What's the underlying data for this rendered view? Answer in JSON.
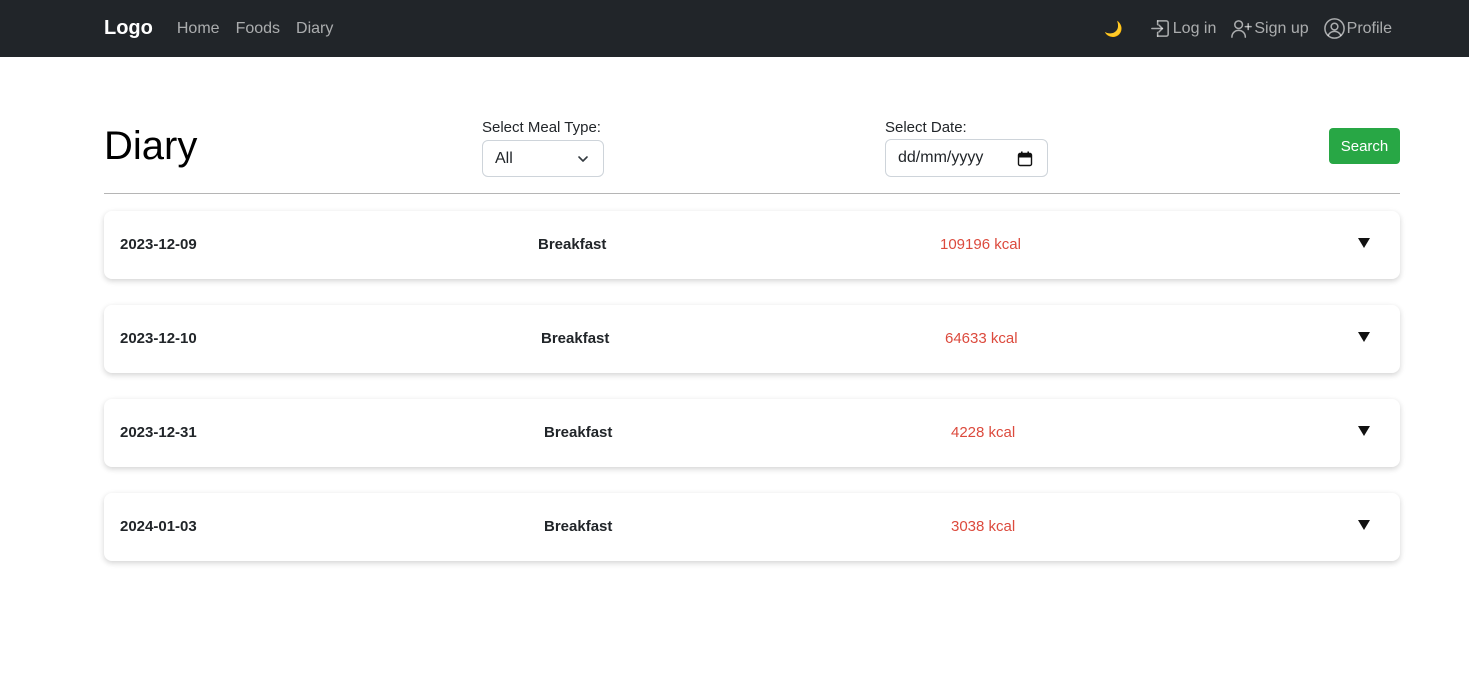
{
  "nav": {
    "logo": "Logo",
    "links": [
      "Home",
      "Foods",
      "Diary"
    ],
    "theme_icon": "🌙",
    "login": "Log in",
    "signup": "Sign up",
    "profile": "Profile"
  },
  "page": {
    "title": "Diary"
  },
  "filters": {
    "meal_label": "Select Meal Type:",
    "meal_value": "All",
    "date_label": "Select Date:",
    "date_placeholder": "dd/mm/yyyy",
    "search_label": "Search"
  },
  "entries": [
    {
      "date": "2023-12-09",
      "meal": "Breakfast",
      "kcal": "109196 kcal"
    },
    {
      "date": "2023-12-10",
      "meal": "Breakfast",
      "kcal": "64633 kcal"
    },
    {
      "date": "2023-12-31",
      "meal": "Breakfast",
      "kcal": "4228 kcal"
    },
    {
      "date": "2024-01-03",
      "meal": "Breakfast",
      "kcal": "3038 kcal"
    }
  ],
  "colors": {
    "navbar": "#212529",
    "accent_green": "#28a745",
    "kcal_red": "#dc4a3d"
  }
}
